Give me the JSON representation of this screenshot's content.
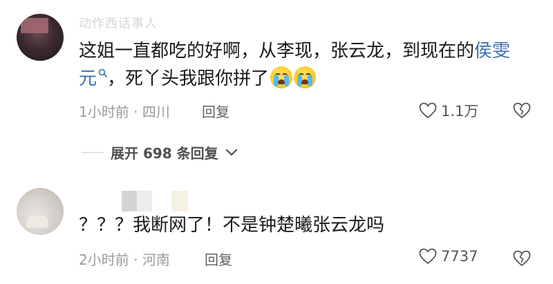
{
  "comments": [
    {
      "username": "动作西话事人",
      "text_before": "这姐一直都吃的好啊，从李现，张云龙，到现在的",
      "link_text": "侯雯元",
      "text_after": "，死丫头我跟你拼了",
      "emoji": [
        "loudly-crying-face",
        "loudly-crying-face"
      ],
      "time": "1小时前",
      "location": "四川",
      "reply_label": "回复",
      "likes": "1.1万"
    },
    {
      "username": "",
      "text": "？？？我断网了！不是钟楚曦张云龙吗",
      "time": "2小时前",
      "location": "河南",
      "reply_label": "回复",
      "likes": "7737"
    }
  ],
  "expand_replies": {
    "label": "展开 698 条回复"
  },
  "colors": {
    "link": "#3a6fb0",
    "meta": "#9a9a9a",
    "emoji": "#ffc928"
  }
}
